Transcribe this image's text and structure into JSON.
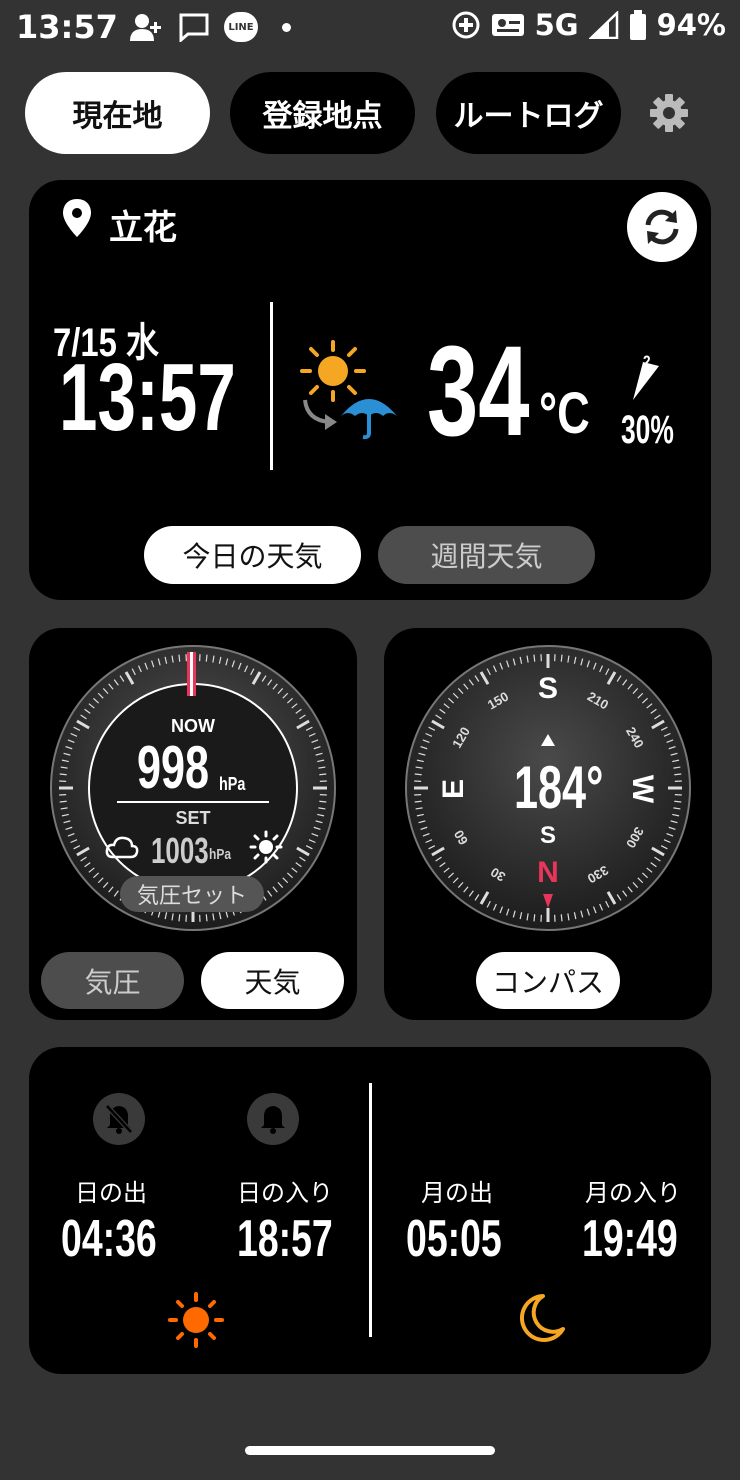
{
  "status_bar": {
    "time": "13:57",
    "line_label": "LINE",
    "network": "5G",
    "battery": "94%"
  },
  "tabs": [
    {
      "label": "現在地",
      "active": true
    },
    {
      "label": "登録地点",
      "active": false
    },
    {
      "label": "ルートログ",
      "active": false
    }
  ],
  "weather": {
    "location": "立花",
    "date": "7/15 水",
    "time": "13:57",
    "forecast_icon": "sun-to-umbrella",
    "temperature": "34",
    "temperature_unit": "°C",
    "wind_level": "2",
    "precip_chance": "30%",
    "today_button": "今日の天気",
    "weekly_button": "週間天気"
  },
  "barometer": {
    "now_label": "NOW",
    "now_value": "998",
    "unit": "hPa",
    "set_label": "SET",
    "set_value": "1003",
    "set_button": "気圧セット",
    "tab_pressure": "気圧",
    "tab_weather": "天気"
  },
  "compass": {
    "heading": "184°",
    "direction": "S",
    "cardinal_top": "S",
    "cardinal_left": "E",
    "cardinal_right": "W",
    "cardinal_bottom": "N",
    "dial_labels": [
      "150",
      "210",
      "120",
      "240",
      "60",
      "300",
      "30",
      "330"
    ],
    "button": "コンパス"
  },
  "sun_moon": {
    "sunrise_label": "日の出",
    "sunrise_time": "04:36",
    "sunset_label": "日の入り",
    "sunset_time": "18:57",
    "moonrise_label": "月の出",
    "moonrise_time": "05:05",
    "moonset_label": "月の入り",
    "moonset_time": "19:49"
  },
  "colors": {
    "accent_red": "#e8355a",
    "sun_orange": "#ff6a00",
    "moon_orange": "#f5a623",
    "umbrella_blue": "#2a8fd4"
  }
}
